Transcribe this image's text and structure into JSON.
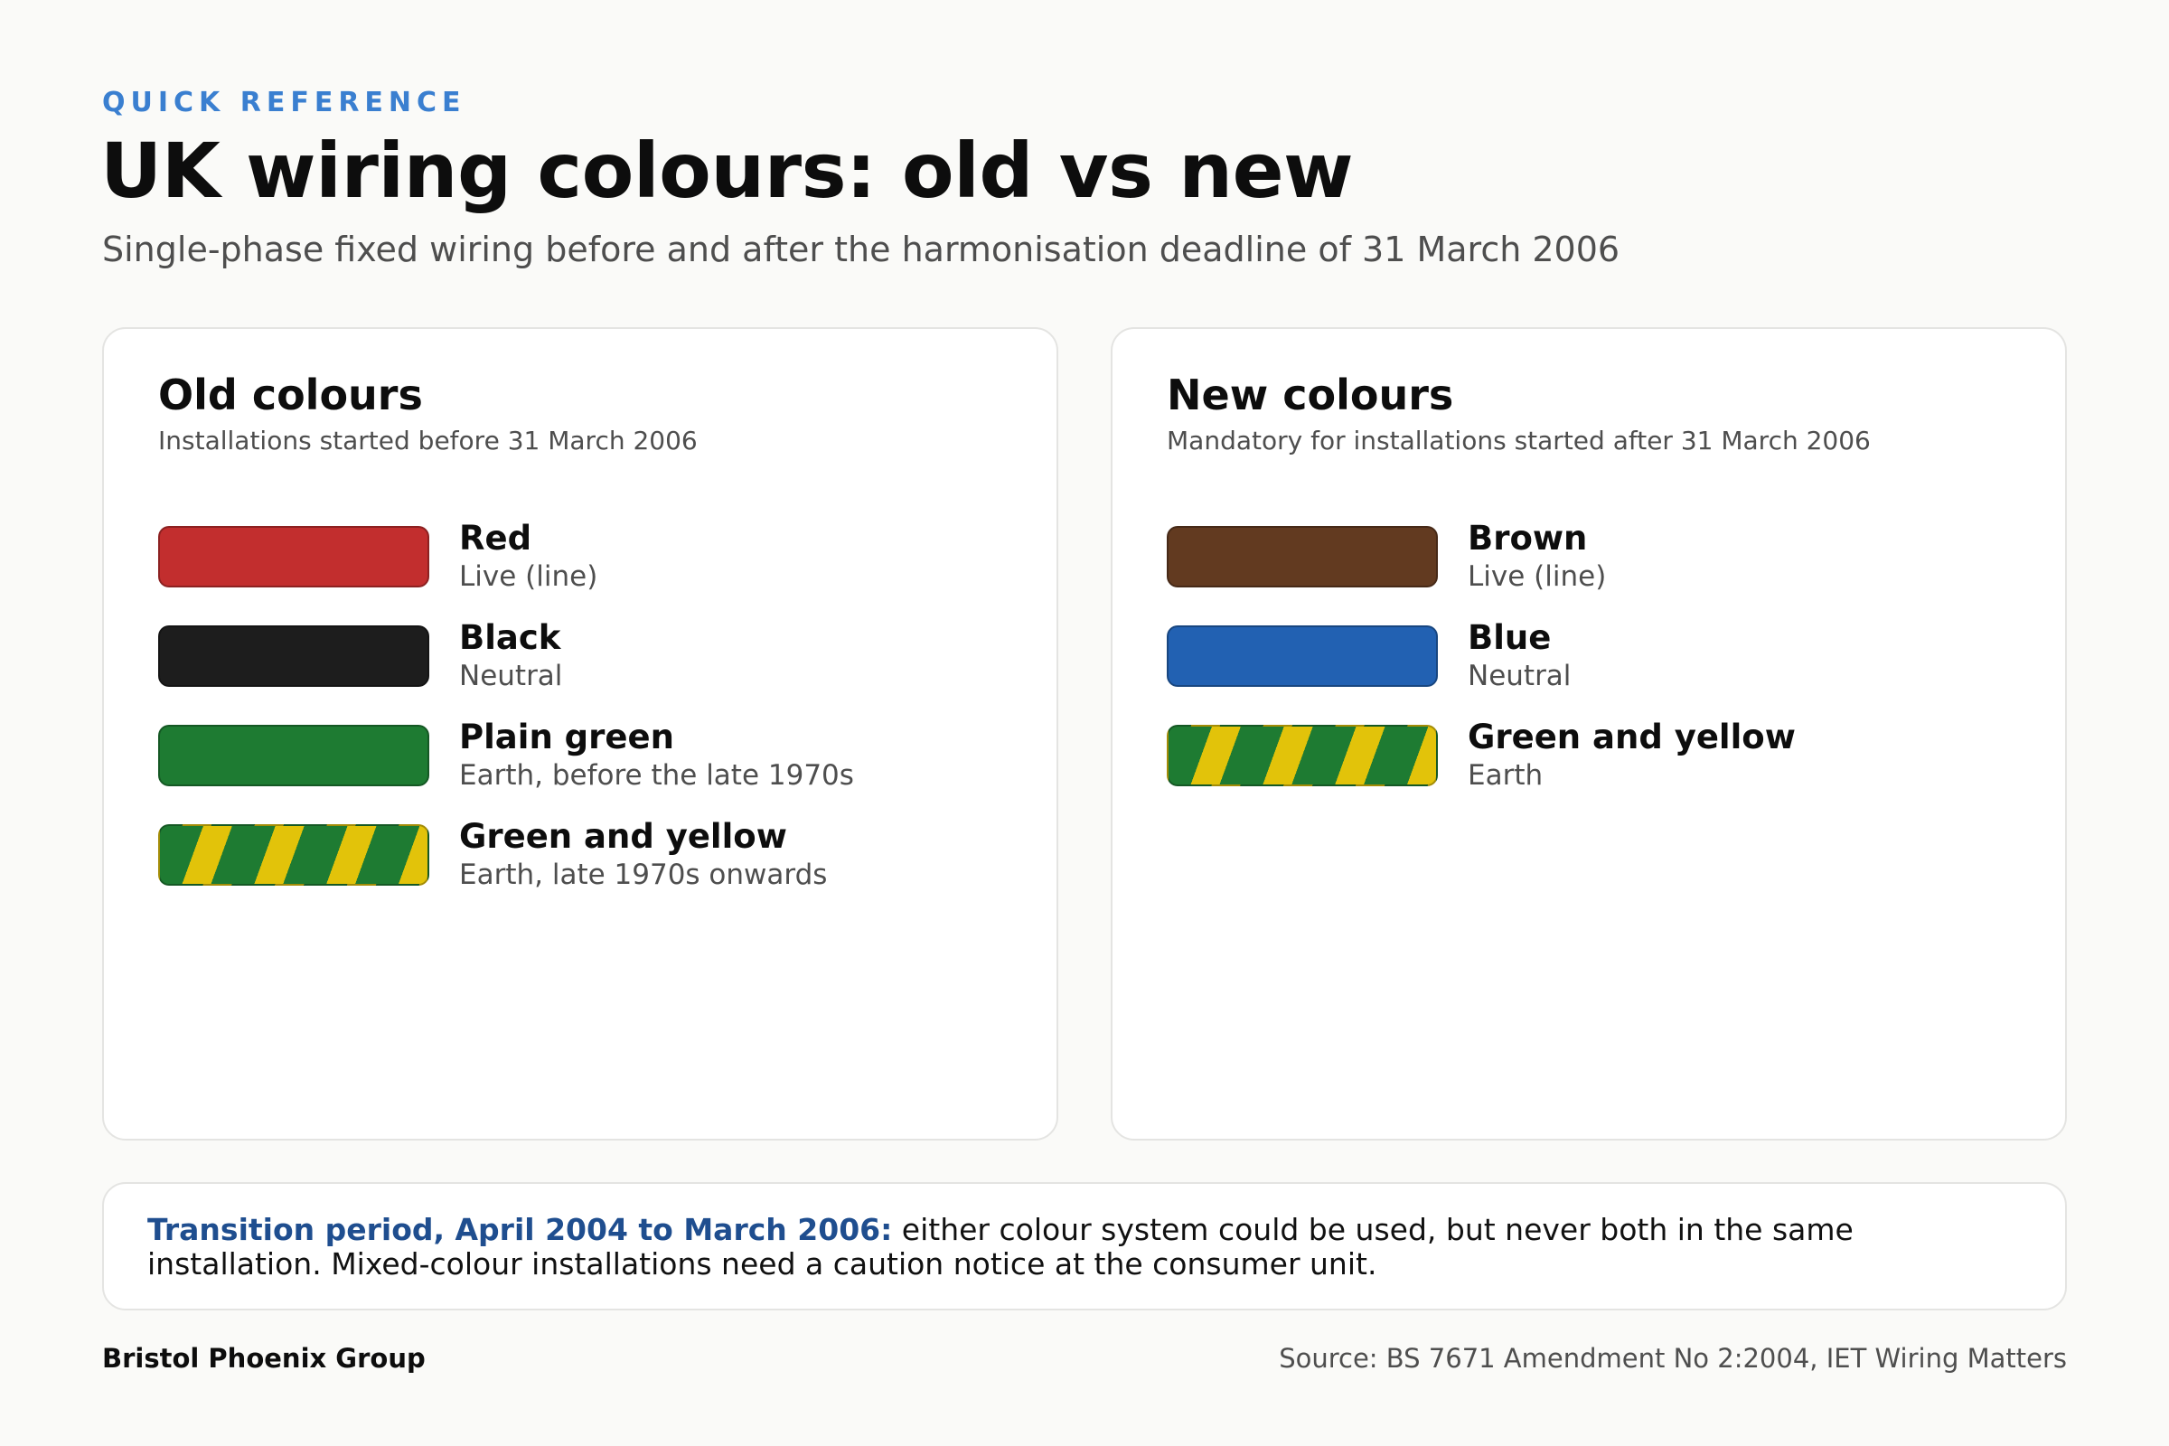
{
  "header": {
    "eyebrow": "QUICK REFERENCE",
    "title": "UK wiring colours: old vs new",
    "subtitle": "Single-phase fixed wiring before and after the harmonisation deadline of 31 March 2006"
  },
  "old_card": {
    "title": "Old colours",
    "subtitle": "Installations started before 31 March 2006",
    "rows": [
      {
        "name": "Red",
        "role": "Live (line)",
        "color": "#c22e2e",
        "pattern": "solid"
      },
      {
        "name": "Black",
        "role": "Neutral",
        "color": "#1d1d1d",
        "pattern": "solid"
      },
      {
        "name": "Plain green",
        "role": "Earth, before the late 1970s",
        "color": "#1e7b32",
        "pattern": "solid"
      },
      {
        "name": "Green and yellow",
        "role": "Earth, late 1970s onwards",
        "color": "#1e7b32",
        "stripe_color": "#e2c30a",
        "pattern": "stripe"
      }
    ]
  },
  "new_card": {
    "title": "New colours",
    "subtitle": "Mandatory for installations started after 31 March 2006",
    "rows": [
      {
        "name": "Brown",
        "role": "Live (line)",
        "color": "#623a20",
        "pattern": "solid"
      },
      {
        "name": "Blue",
        "role": "Neutral",
        "color": "#2261b2",
        "pattern": "solid"
      },
      {
        "name": "Green and yellow",
        "role": "Earth",
        "color": "#1e7b32",
        "stripe_color": "#e2c30a",
        "pattern": "stripe"
      }
    ]
  },
  "note": {
    "lead": "Transition period, April 2004 to March 2006:",
    "body": " either colour system could be used, but never both in the same installation. Mixed-colour installations need a caution notice at the consumer unit."
  },
  "footer": {
    "brand": "Bristol Phoenix Group",
    "source": "Source: BS 7671 Amendment No 2:2004, IET Wiring Matters"
  },
  "colors": {
    "accent": "#3a7fd0",
    "note_lead": "#1f4e8f",
    "background": "#fafaf8"
  }
}
